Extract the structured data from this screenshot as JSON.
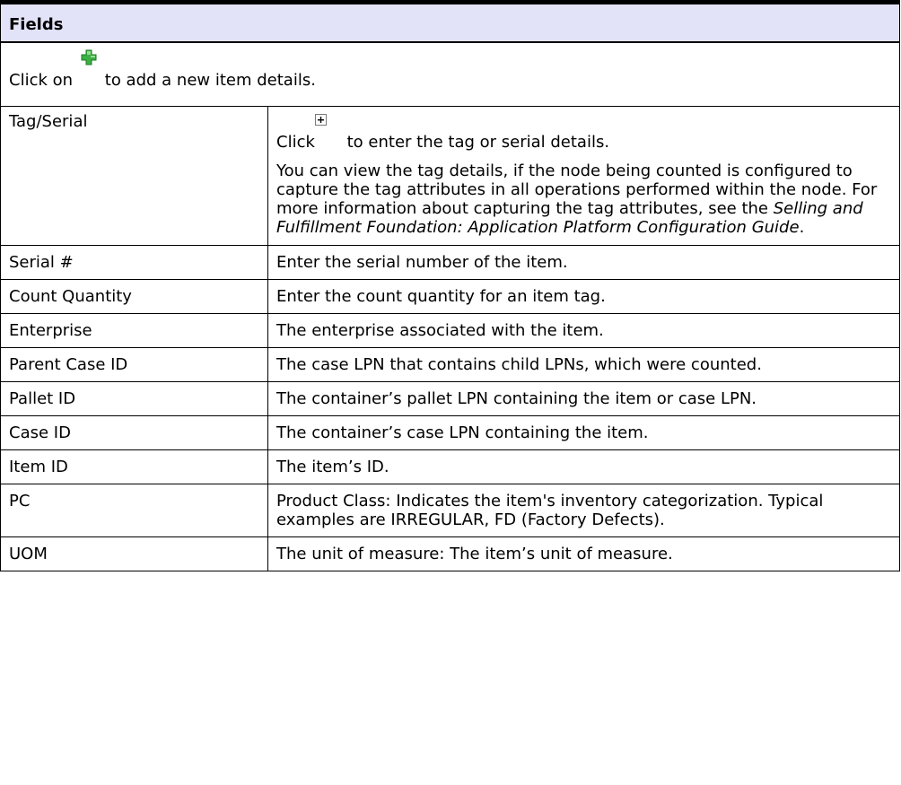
{
  "table": {
    "header": "Fields",
    "intro": {
      "before_icon": "Click on",
      "icon": "green-plus-icon",
      "after_icon": " to add a new item details."
    },
    "tag_serial": {
      "name": "Tag/Serial",
      "line1_before": "Click",
      "line1_icon": "expand-plus-box-icon",
      "line1_after": " to enter the tag or serial details.",
      "para2_text": "You can view the tag details, if the node being counted is configured to capture the tag attributes in all operations performed within the node. For more information about capturing the tag attributes, see the ",
      "para2_italic": "Selling and Fulfillment Foundation: Application Platform Configuration Guide",
      "para2_end": "."
    },
    "rows": [
      {
        "name": "Serial #",
        "desc": "Enter the serial number of the item."
      },
      {
        "name": "Count Quantity",
        "desc": "Enter the count quantity for an item tag."
      },
      {
        "name": "Enterprise",
        "desc": "The enterprise associated with the item."
      },
      {
        "name": "Parent Case ID",
        "desc": "The case LPN that contains child LPNs, which were counted."
      },
      {
        "name": "Pallet ID",
        "desc": "The container’s pallet LPN containing the item or case LPN."
      },
      {
        "name": "Case ID",
        "desc": "The container’s case LPN containing the item."
      },
      {
        "name": "Item ID",
        "desc": "The item’s ID."
      },
      {
        "name": "PC",
        "desc": "Product Class: Indicates the item's inventory categorization. Typical examples are IRREGULAR, FD (Factory Defects)."
      },
      {
        "name": "UOM",
        "desc": "The unit of measure: The item’s unit of measure."
      }
    ]
  },
  "colors": {
    "header_bg": "#e2e2f8",
    "icon_green": "#3cb043",
    "border": "#000000"
  }
}
